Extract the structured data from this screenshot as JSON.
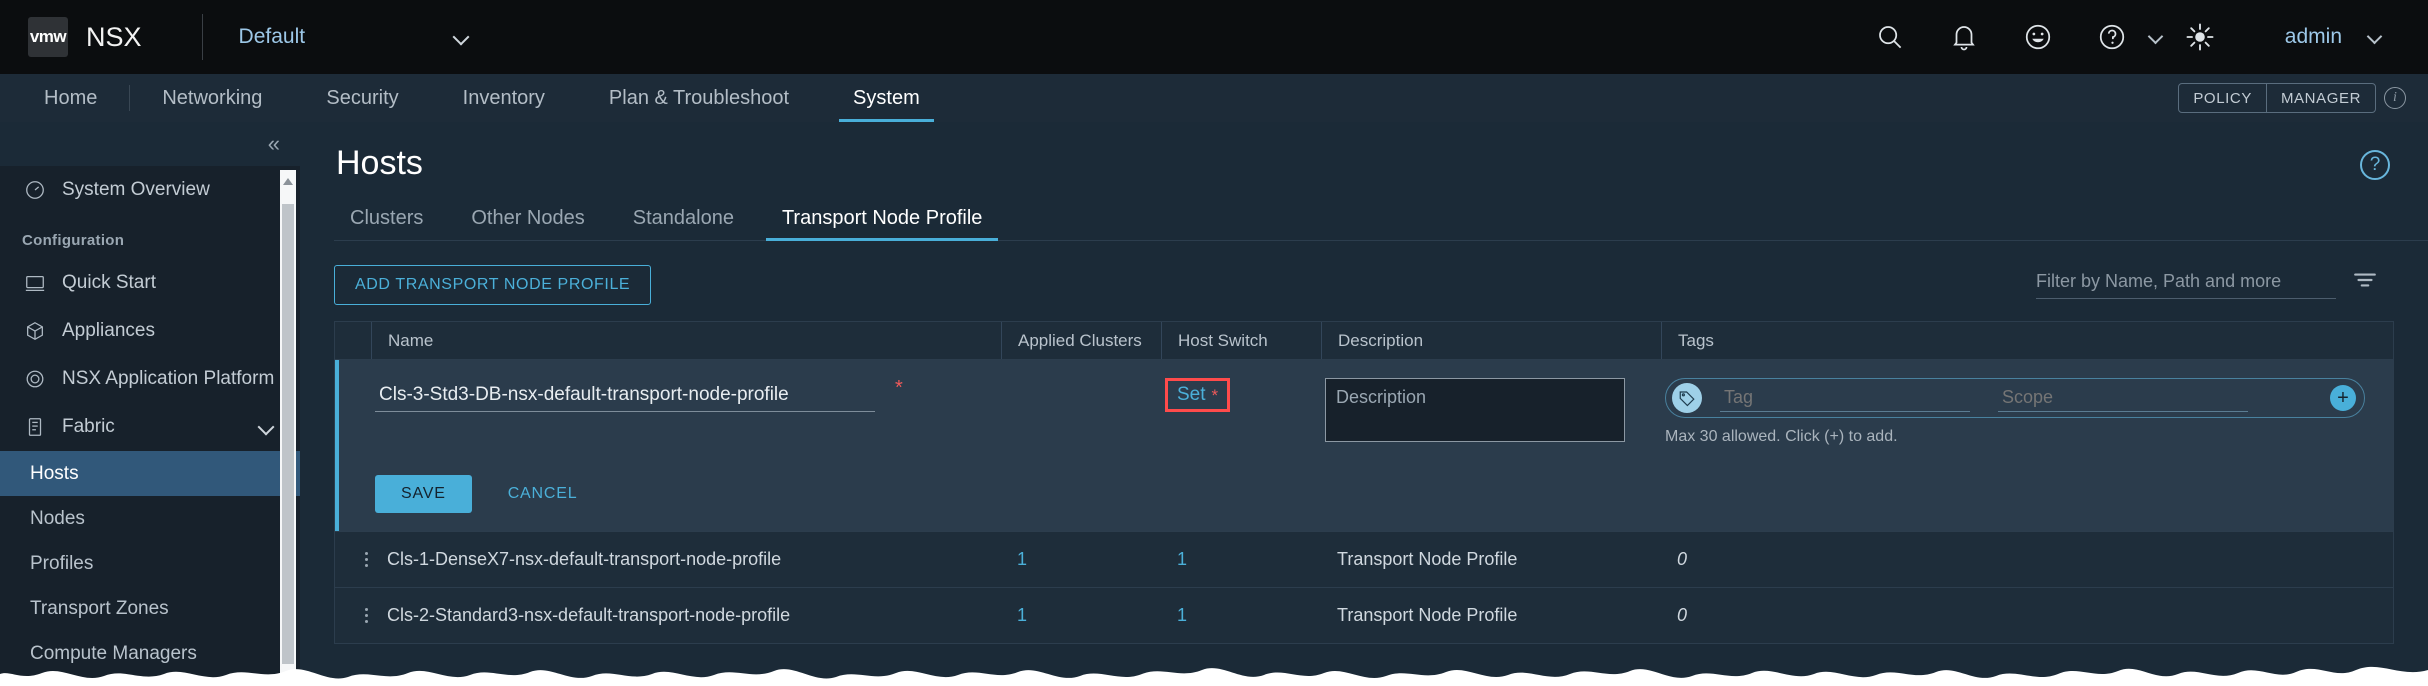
{
  "header": {
    "logo_text": "vmw",
    "product": "NSX",
    "tenant": "Default",
    "user": "admin",
    "icons": [
      "search-icon",
      "bell-icon",
      "smiley-icon",
      "help-icon",
      "brightness-icon"
    ]
  },
  "nav": {
    "items": [
      {
        "label": "Home",
        "active": false
      },
      {
        "label": "Networking",
        "active": false
      },
      {
        "label": "Security",
        "active": false
      },
      {
        "label": "Inventory",
        "active": false
      },
      {
        "label": "Plan & Troubleshoot",
        "active": false
      },
      {
        "label": "System",
        "active": true
      }
    ],
    "mode_policy": "POLICY",
    "mode_manager": "MANAGER",
    "info_glyph": "i"
  },
  "sidebar": {
    "overview": {
      "label": "System Overview",
      "icon": "dashboard-icon"
    },
    "group_label": "Configuration",
    "items": [
      {
        "label": "Quick Start",
        "icon": "monitor-icon"
      },
      {
        "label": "Appliances",
        "icon": "cube-icon"
      },
      {
        "label": "NSX Application Platform",
        "icon": "platform-icon"
      }
    ],
    "fabric": {
      "label": "Fabric",
      "icon": "rack-icon"
    },
    "fabric_children": [
      {
        "label": "Hosts",
        "selected": true
      },
      {
        "label": "Nodes",
        "selected": false
      },
      {
        "label": "Profiles",
        "selected": false
      },
      {
        "label": "Transport Zones",
        "selected": false
      },
      {
        "label": "Compute Managers",
        "selected": false
      }
    ],
    "collapse_glyph": "«"
  },
  "main": {
    "title": "Hosts",
    "help_glyph": "?",
    "tabs": [
      {
        "label": "Clusters",
        "active": false
      },
      {
        "label": "Other Nodes",
        "active": false
      },
      {
        "label": "Standalone",
        "active": false
      },
      {
        "label": "Transport Node Profile",
        "active": true
      }
    ],
    "add_button": "ADD TRANSPORT NODE PROFILE",
    "filter_placeholder": "Filter by Name, Path and more",
    "filter_value": ""
  },
  "table": {
    "columns": [
      "Name",
      "Applied Clusters",
      "Host Switch",
      "Description",
      "Tags"
    ],
    "edit_row": {
      "name_value": "Cls-3-Std3-DB-nsx-default-transport-node-profile",
      "name_required_mark": "*",
      "host_switch_label": "Set",
      "host_switch_required_mark": "*",
      "description_placeholder": "Description",
      "description_value": "",
      "tag_placeholder": "Tag",
      "scope_placeholder": "Scope",
      "tag_value": "",
      "scope_value": "",
      "plus_glyph": "+",
      "tag_help": "Max 30 allowed. Click (+) to add.",
      "save_label": "SAVE",
      "cancel_label": "CANCEL"
    },
    "rows": [
      {
        "name": "Cls-1-DenseX7-nsx-default-transport-node-profile",
        "applied_clusters": "1",
        "host_switch": "1",
        "description": "Transport Node Profile",
        "tags": "0"
      },
      {
        "name": "Cls-2-Standard3-nsx-default-transport-node-profile",
        "applied_clusters": "1",
        "host_switch": "1",
        "description": "Transport Node Profile",
        "tags": "0"
      }
    ]
  },
  "colors": {
    "accent": "#49afd9",
    "header_bg": "#0b0d0f",
    "page_bg": "#1b2a37",
    "sidebar_bg": "#17212b",
    "selected_item": "#31587a",
    "edit_row_bg": "#2b3c4c",
    "required_red": "#f05a5a",
    "highlight_red": "#ff4b4b"
  }
}
